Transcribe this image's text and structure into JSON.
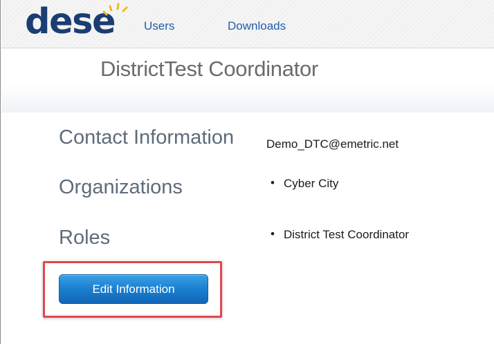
{
  "header": {
    "logo_text": "dese",
    "nav": [
      {
        "label": "Users"
      },
      {
        "label": "Downloads"
      }
    ]
  },
  "page": {
    "title": "DistrictTest Coordinator"
  },
  "sections": {
    "contact": {
      "label": "Contact Information",
      "email": "Demo_DTC@emetric.net"
    },
    "organizations": {
      "label": "Organizations",
      "items": [
        "Cyber City"
      ]
    },
    "roles": {
      "label": "Roles",
      "items": [
        "District Test Coordinator"
      ]
    }
  },
  "actions": {
    "edit_label": "Edit Information"
  },
  "colors": {
    "logo": "#1b3d73",
    "logo_rays": "#f3b61f",
    "link": "#1f5ea8",
    "button": "#1b7fd0",
    "highlight": "#e0474c"
  },
  "icons": {
    "logo_accent": "sun-rays-icon",
    "list_bullet": "bullet-icon"
  }
}
